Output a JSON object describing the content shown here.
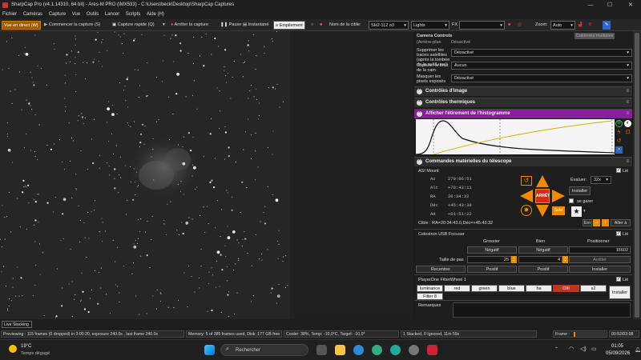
{
  "window": {
    "title": "SharpCap Pro (v4.1.14310, 64 bit) - Ares-M PRO (IMX533) - C:\\Users\\beck\\Desktop\\SharpCap Captures",
    "minimize": "—",
    "maximize": "☐",
    "close": "✕"
  },
  "menu": [
    "Fichier",
    "Caméras",
    "Capture",
    "Vue",
    "Outils",
    "Lancer",
    "Scripts",
    "Aide (H)"
  ],
  "toolbar": {
    "live_view": "Vue en direct (W)",
    "start_capture": "Commencer la capture (S)",
    "quick_capture": "Capture rapide (Q)",
    "stop_capture": "Arrêter la capture",
    "pause": "Pause",
    "snapshot": "Instantané",
    "stacking": "Empilement",
    "target_label": "Nom de la cible:",
    "target_value": "SH2-112 o3",
    "frame_type": "Lights",
    "fx_label": "FX",
    "fx_value": "",
    "zoom_label": "Zoom:",
    "zoom_value": "Auto"
  },
  "panel": {
    "header_title": "Camera Controls",
    "multi_cols": "Colonnes multiples",
    "row_first_label": "(Arrière-plan",
    "row_first_value": "Désactivé",
    "row1_label": "Supprimer les traces satellites (après la tombée de la nuit/Lune)",
    "row1_value": "Désactivé",
    "row2_label": "Capturer le bruit de la cam",
    "row2_value": "Aucun",
    "row3_label": "Masquer les pixels exposés",
    "row3_value": "Désactivé",
    "image_controls": "Contrôles d'image",
    "thermal_controls": "Contrôles thermiques",
    "histogram_title": "Afficher l'étirement de l'histogramme",
    "telescope_title": "Commandes matérielles du télescope",
    "mount": {
      "name": "ASI Mount",
      "linked": "Lié",
      "az_label": "Az",
      "az": "279:06:51",
      "alt_label": "Alt",
      "alt": "+70:43:11",
      "ra_label": "RA",
      "ra": "20:34:32",
      "dec_label": "Déc",
      "dec": "+45:43:30",
      "ah_label": "AH",
      "ah": "+01:51:22",
      "stop": "ARRÊT",
      "slew_label": "Évaluer:",
      "slew_value": "32x",
      "install": "Installer",
      "guide": "se garer",
      "follow": "Suivi",
      "target": "Cible : RA=20:34:43.0,Déc=+45:43:32",
      "goto_prefix": "Em",
      "goto": "Aller à"
    },
    "focuser": {
      "name": "Celestron USB Focuser",
      "linked": "Lié",
      "col_coarse": "Grossier",
      "col_fine": "Bien",
      "col_position": "Positionner",
      "negative": "Négatif",
      "negative2": "Négatif",
      "position": "15602",
      "step_label": "Taille de pas",
      "step_coarse": "25",
      "step_fine": "4",
      "stop": "Arrêter",
      "positive": "Positif",
      "positive2": "Positif",
      "recenter": "Recentrer",
      "install": "Installer"
    },
    "filterwheel": {
      "name": "PlayerOne FilterWheel 1",
      "linked": "Lié",
      "filters": [
        "luminance",
        "red",
        "green",
        "blue",
        "ha",
        "OIII",
        "s2"
      ],
      "extra": "Filter 8",
      "active_index": 5,
      "install": "Installer"
    },
    "remarks_label": "Remarques"
  },
  "status": {
    "live_stacking": "Live Stacking",
    "previewing": "Previewing : 115 frames (0 dropped) in 3:00:20, exposure 240.0s , last frame 240.0s",
    "memory": "Memory: 5 of 385 frames used, Disk: 177 GB free",
    "cooler": "Cooler: 38%, Temp: -10,0°C, Target: -10,0°",
    "stacked": "1 Stacked, 0 Ignored, 11m 59s",
    "frame_label": "Frame :",
    "frame_time": "00:52/03:08",
    "frame_progress": 0.05
  },
  "taskbar": {
    "weather_temp": "19°C",
    "weather_desc": "Temps dégagé",
    "search_placeholder": "Rechercher",
    "time": "01:05",
    "date": "05/09/2026"
  },
  "colors": {
    "accent": "#c97800",
    "histogram_header": "#8a1c9e",
    "arrow_orange": "#f28a00",
    "stop_red": "#d8281e"
  }
}
